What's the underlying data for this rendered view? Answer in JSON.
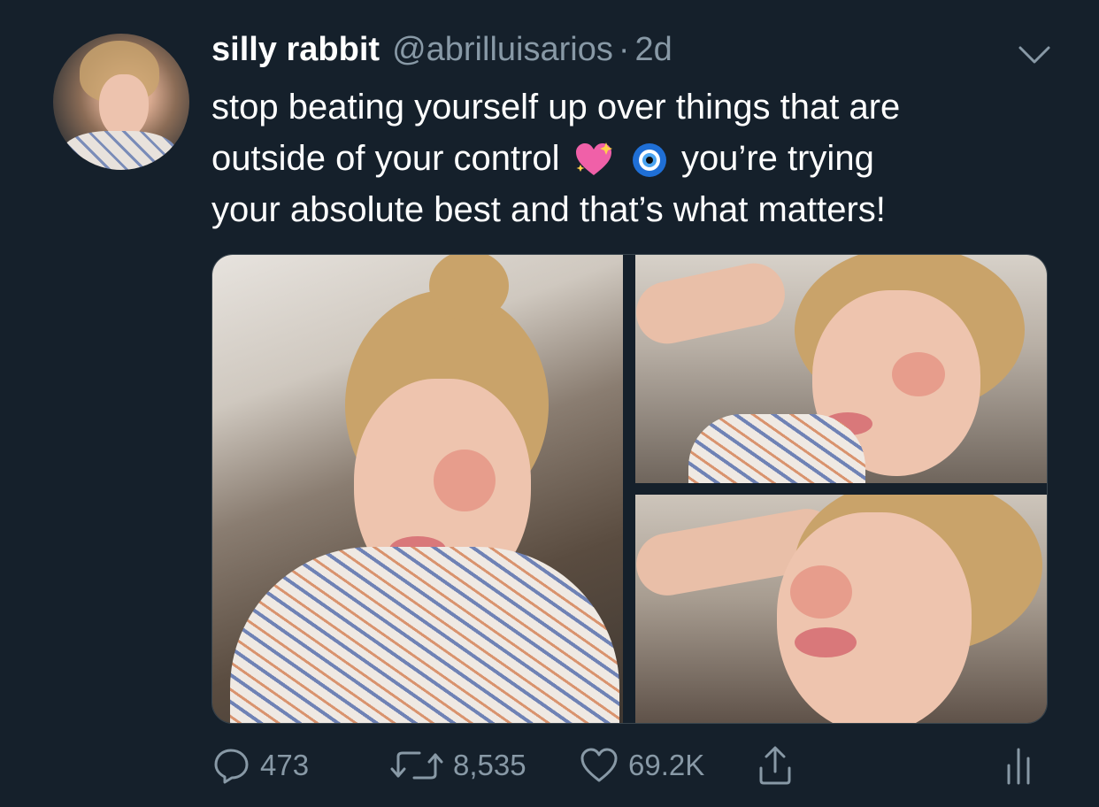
{
  "tweet": {
    "display_name": "silly rabbit",
    "handle": "@abrilluisarios",
    "separator": "·",
    "timestamp": "2d",
    "text_line1": "stop beating yourself up over things that are",
    "text_line2_pre": "outside of your control",
    "text_line2_post": "you’re trying",
    "text_line3": "your absolute best and that’s what matters!",
    "emojis": [
      "sparkling-heart-emoji",
      "nazar-amulet-emoji"
    ]
  },
  "actions": {
    "reply_count": "473",
    "retweet_count": "8,535",
    "like_count": "69.2K"
  },
  "icons": {
    "reply": "reply-icon",
    "retweet": "retweet-icon",
    "like": "heart-icon",
    "share": "share-icon",
    "stats": "analytics-icon",
    "menu": "chevron-down-icon"
  },
  "colors": {
    "background": "#15202b",
    "secondary_text": "#8899a6",
    "primary_text": "#ffffff",
    "border": "#38444d"
  }
}
